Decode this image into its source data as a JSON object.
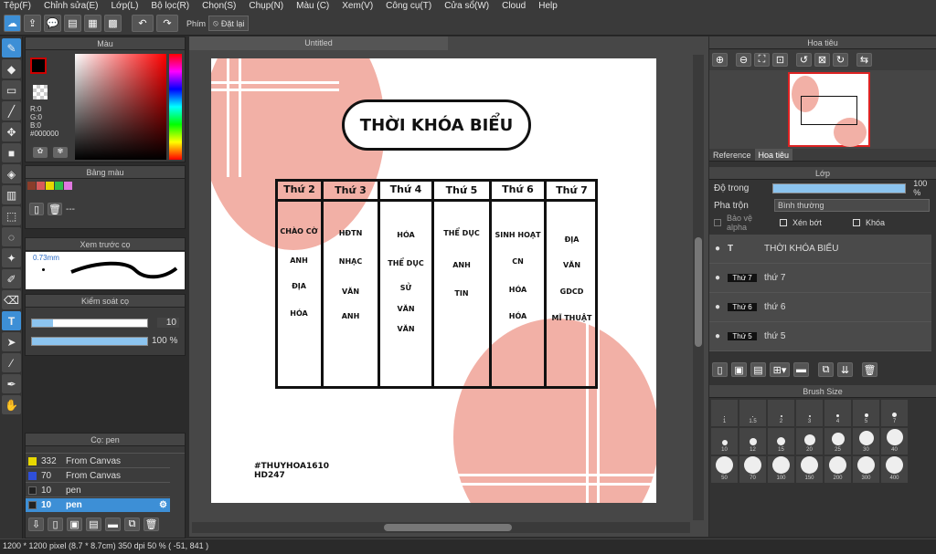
{
  "menu": [
    "Tệp(F)",
    "Chỉnh sửa(E)",
    "Lớp(L)",
    "Bộ lọc(R)",
    "Chọn(S)",
    "Chụp(N)",
    "Màu (C)",
    "Xem(V)",
    "Công cụ(T)",
    "Cửa sổ(W)",
    "Cloud",
    "Help"
  ],
  "toolbar": {
    "snap_label": "Phím",
    "reset_label": "Đặt lại"
  },
  "color_panel": {
    "title": "Màu",
    "r": "R:0",
    "g": "G:0",
    "b": "B:0",
    "hex": "#000000"
  },
  "palette_panel": {
    "title": "Bảng màu",
    "dash": "---"
  },
  "brush_preview": {
    "title": "Xem trước cọ",
    "size": "0.73mm"
  },
  "brush_control": {
    "title": "Kiểm soát cọ",
    "size_val": "10",
    "opacity_val": "100 %"
  },
  "brush_list": {
    "title": "Cọ: pen",
    "items": [
      {
        "num": "332",
        "name": "From Canvas",
        "color": "#e8d800"
      },
      {
        "num": "70",
        "name": "From Canvas",
        "color": "#2f4fd8"
      },
      {
        "num": "10",
        "name": "pen",
        "color": "#222"
      },
      {
        "num": "10",
        "name": "pen",
        "color": "#222",
        "selected": true
      }
    ]
  },
  "canvas": {
    "tab": "Untitled"
  },
  "schedule": {
    "title": "THỜI KHÓA BIỂU",
    "days": [
      "Thứ 2",
      "Thứ 3",
      "Thứ 4",
      "Thứ 5",
      "Thứ 6",
      "Thứ 7"
    ],
    "col1": [
      "CHÀO CỜ",
      "ANH",
      "ĐỊA",
      "HÓA"
    ],
    "col2": [
      "HĐTN",
      "NHẠC",
      "VĂN",
      "ANH"
    ],
    "col3": [
      "HÓA",
      "THỂ DỤC",
      "SỬ",
      "VĂN",
      "VĂN"
    ],
    "col4": [
      "THỂ DỤC",
      "ANH",
      "TIN"
    ],
    "col5": [
      "SINH HOẠT",
      "CN",
      "HÓA",
      "HÓA"
    ],
    "col6": [
      "ĐỊA",
      "VĂN",
      "GDCD",
      "MĨ THUẬT"
    ],
    "tag1": "#THUYHOA1610",
    "tag2": "HD247"
  },
  "navigator": {
    "title": "Hoa tiêu",
    "tab_ref": "Reference",
    "tab_nav": "Hoa tiêu"
  },
  "layers": {
    "title": "Lớp",
    "opacity_label": "Độ trong",
    "opacity_val": "100 %",
    "blend_label": "Pha trộn",
    "blend_val": "Bình thường",
    "protect": "Bảo vệ alpha",
    "clip": "Xén bớt",
    "lock": "Khóa",
    "items": [
      {
        "thumb": "",
        "name": "THỜI KHÓA BIỂU"
      },
      {
        "thumb": "Thứ 7",
        "name": "thứ 7"
      },
      {
        "thumb": "Thứ 6",
        "name": "thứ 6"
      },
      {
        "thumb": "Thứ 5",
        "name": "thứ 5"
      }
    ]
  },
  "brush_size": {
    "title": "Brush Size",
    "sizes": [
      "1",
      "1.5",
      "2",
      "3",
      "4",
      "5",
      "7",
      "10",
      "12",
      "15",
      "20",
      "25",
      "30",
      "40",
      "50",
      "70",
      "100",
      "150",
      "200",
      "300",
      "400"
    ]
  },
  "status": {
    "text": "1200 * 1200 pixel  (8.7 * 8.7cm)  350 dpi  50 %  ( -51, 841 )"
  },
  "colors": {
    "pink": "#f2b0a6",
    "accent": "#3d8fd6"
  }
}
